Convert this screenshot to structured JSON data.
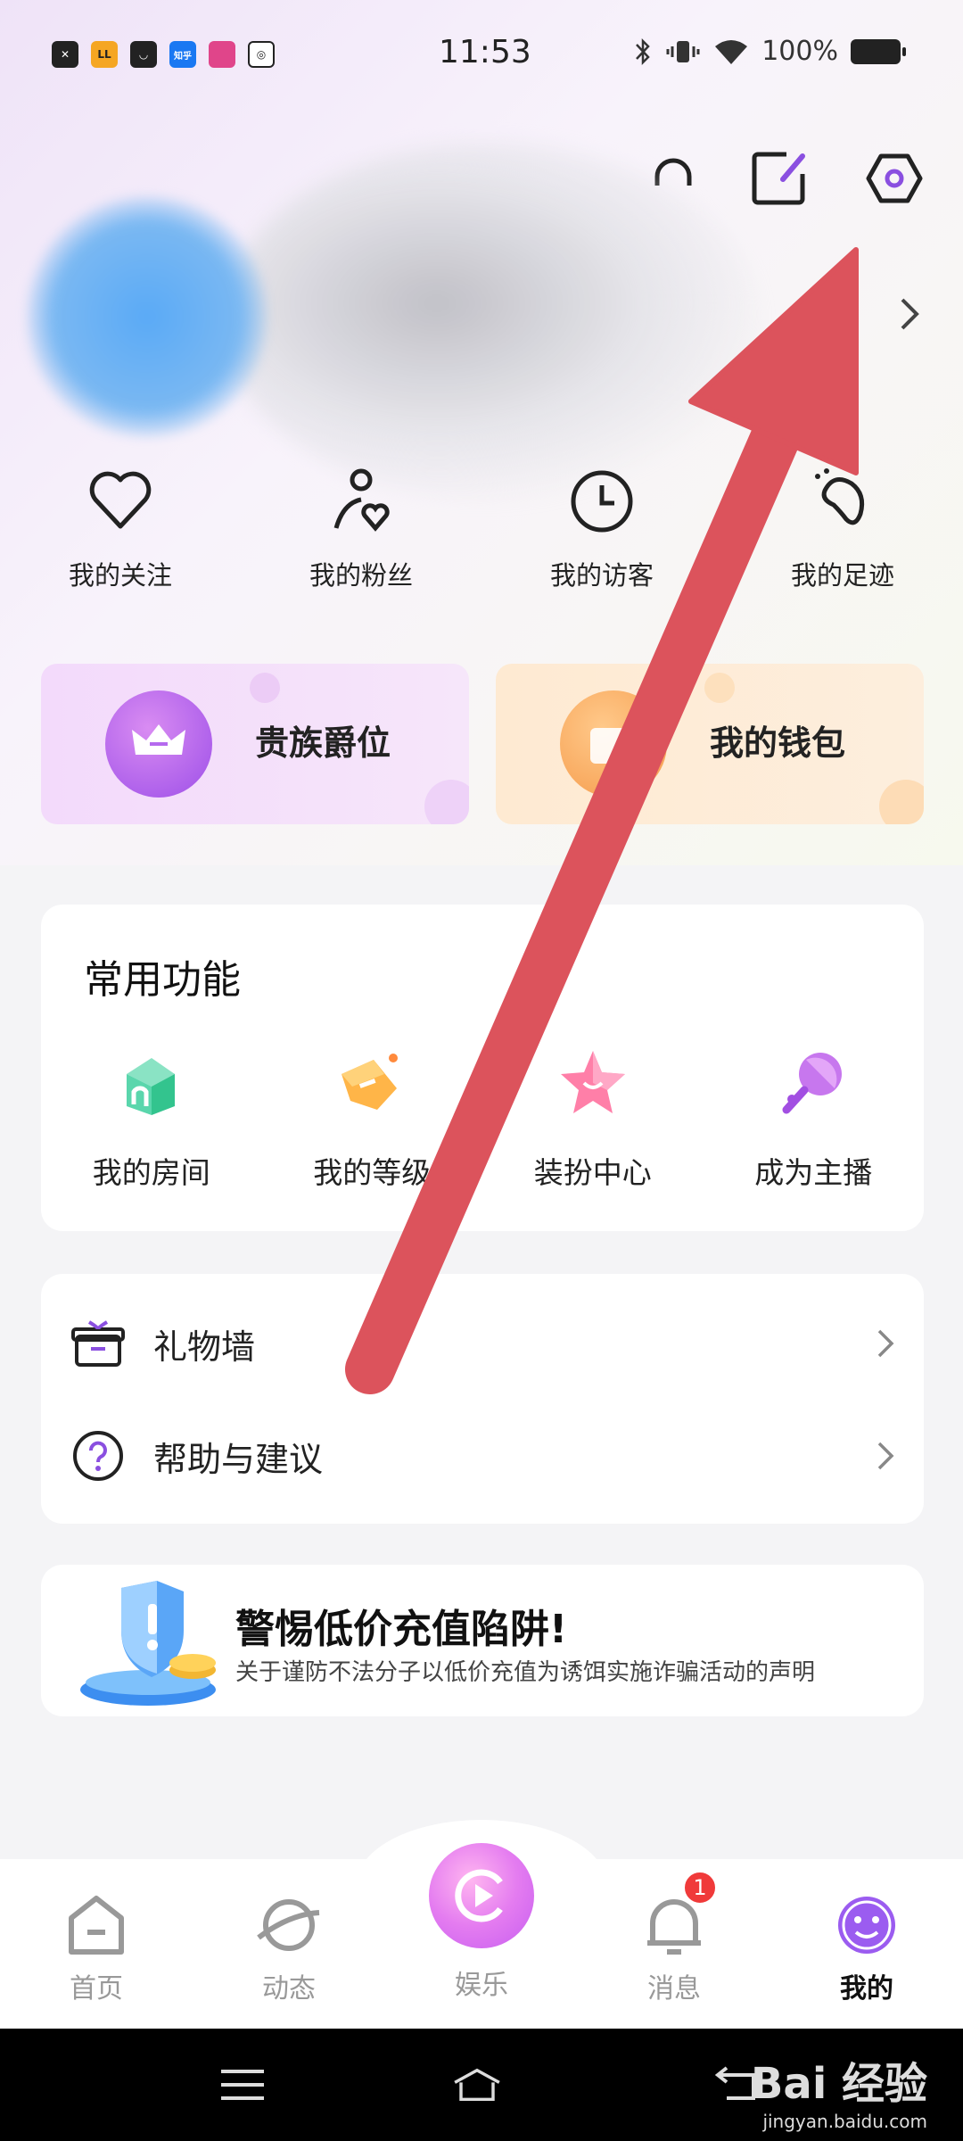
{
  "status_bar": {
    "time": "11:53",
    "battery_text": "100%",
    "notification_icons": [
      "x-app-icon",
      "ll-app-icon",
      "shop-app-icon",
      "zhihu-app-icon",
      "bilibili-app-icon",
      "camera-app-icon"
    ],
    "notif_labels": [
      "✕",
      "LL",
      "◡",
      "知乎",
      "",
      "◎"
    ]
  },
  "header_icons": [
    "headset-icon",
    "edit-note-icon",
    "settings-hexagon-icon"
  ],
  "stats": [
    {
      "label": "我的关注",
      "icon": "heart-icon"
    },
    {
      "label": "我的粉丝",
      "icon": "fans-heart-icon"
    },
    {
      "label": "我的访客",
      "icon": "clock-icon"
    },
    {
      "label": "我的足迹",
      "icon": "footprint-icon"
    }
  ],
  "promo": {
    "nobility_label": "贵族爵位",
    "wallet_label": "我的钱包"
  },
  "common_functions": {
    "title": "常用功能",
    "items": [
      {
        "label": "我的房间",
        "icon": "room-house-icon"
      },
      {
        "label": "我的等级",
        "icon": "level-tag-icon"
      },
      {
        "label": "装扮中心",
        "icon": "dress-star-icon"
      },
      {
        "label": "成为主播",
        "icon": "microphone-icon"
      }
    ]
  },
  "menu": {
    "gift_wall": "礼物墙",
    "help": "帮助与建议"
  },
  "warning": {
    "title": "警惕低价充值陷阱!",
    "subtitle": "关于谨防不法分子以低价充值为诱饵实施诈骗活动的声明"
  },
  "bottom_nav": {
    "home": "首页",
    "feed": "动态",
    "entertainment": "娱乐",
    "messages": "消息",
    "me": "我的",
    "message_badge": "1"
  },
  "watermark": {
    "brand": "Bai 经验",
    "url": "jingyan.baidu.com"
  },
  "colors": {
    "accent_purple": "#8a4fe0",
    "arrow_red": "#dc535c",
    "badge_red": "#f03a3a"
  }
}
